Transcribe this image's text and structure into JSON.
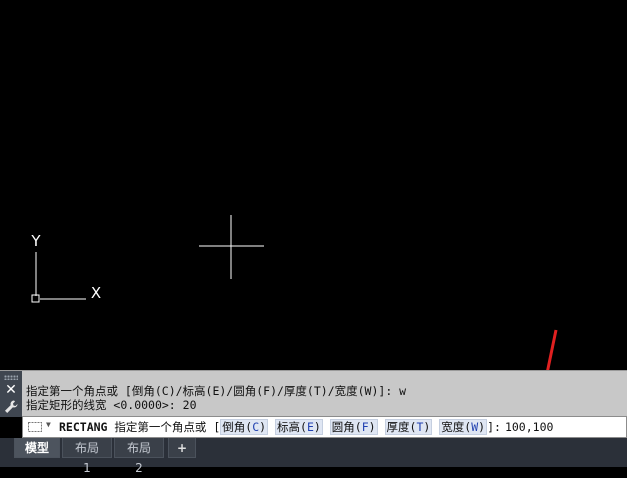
{
  "canvas": {
    "axis_y_label": "Y",
    "axis_x_label": "X",
    "annotation_color": "#e02020"
  },
  "history": {
    "line1": "指定第一个角点或 [倒角(C)/标高(E)/圆角(F)/厚度(T)/宽度(W)]: w",
    "line2": "指定矩形的线宽 <0.0000>: 20",
    "close_icon": "close-icon",
    "settings_icon": "wrench-icon"
  },
  "command_line": {
    "command_icon": "rectangle-command-icon",
    "command": "RECTANG",
    "prompt": "指定第一个角点或",
    "open_bracket": "[",
    "options": [
      {
        "label": "倒角",
        "key": "C"
      },
      {
        "label": "标高",
        "key": "E"
      },
      {
        "label": "圆角",
        "key": "F"
      },
      {
        "label": "厚度",
        "key": "T"
      },
      {
        "label": "宽度",
        "key": "W"
      }
    ],
    "close_bracket": "]:",
    "input": "100,100"
  },
  "tabs": [
    {
      "label": "模型",
      "active": true
    },
    {
      "label": "布局1",
      "active": false
    },
    {
      "label": "布局2",
      "active": false
    },
    {
      "label": "+",
      "active": false
    }
  ]
}
